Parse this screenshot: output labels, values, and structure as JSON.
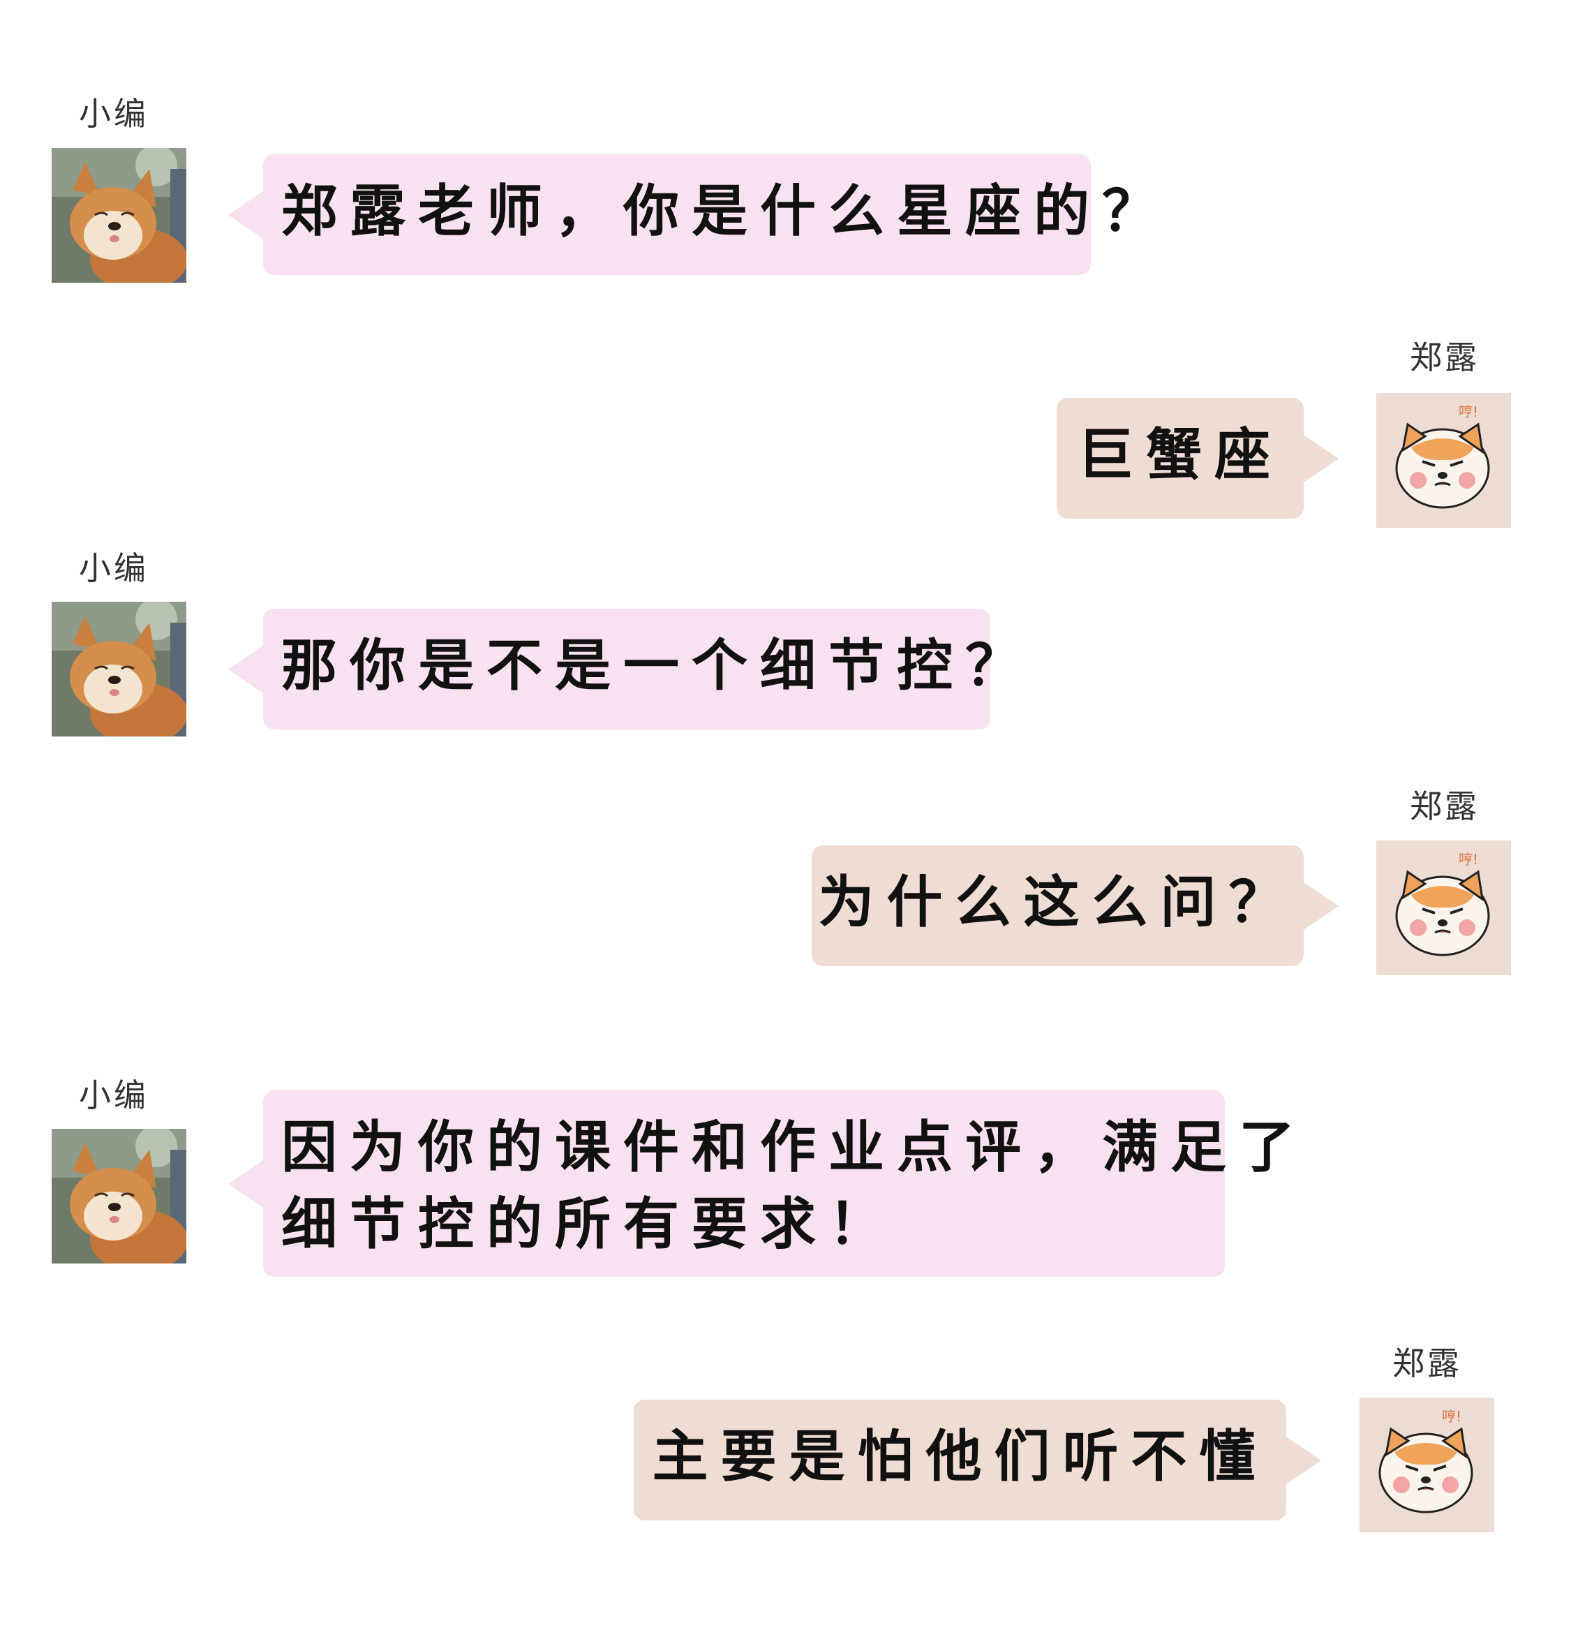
{
  "chat": {
    "participants": {
      "left": "小编",
      "right": "郑露"
    },
    "messages": [
      {
        "sender": "小编",
        "side": "left",
        "lines": [
          "郑露老师，你是什么星座的？"
        ]
      },
      {
        "sender": "郑露",
        "side": "right",
        "lines": [
          "巨蟹座"
        ]
      },
      {
        "sender": "小编",
        "side": "left",
        "lines": [
          "那你是不是一个细节控？"
        ]
      },
      {
        "sender": "郑露",
        "side": "right",
        "lines": [
          "为什么这么问？"
        ]
      },
      {
        "sender": "小编",
        "side": "left",
        "lines": [
          "因为你的课件和作业点评，满足了",
          "细节控的所有要求！"
        ]
      },
      {
        "sender": "郑露",
        "side": "right",
        "lines": [
          "主要是怕他们听不懂"
        ]
      }
    ]
  },
  "avatars": {
    "left": {
      "icon": "shiba-photo-icon"
    },
    "right": {
      "icon": "angry-shiba-sticker-icon",
      "caption": "哼!"
    }
  },
  "colors": {
    "left_bubble": "#f8e1f0",
    "right_bubble": "#efdcd2",
    "right_avatar_bg": "#ecdcd4",
    "text": "#111111",
    "name": "#333333"
  }
}
